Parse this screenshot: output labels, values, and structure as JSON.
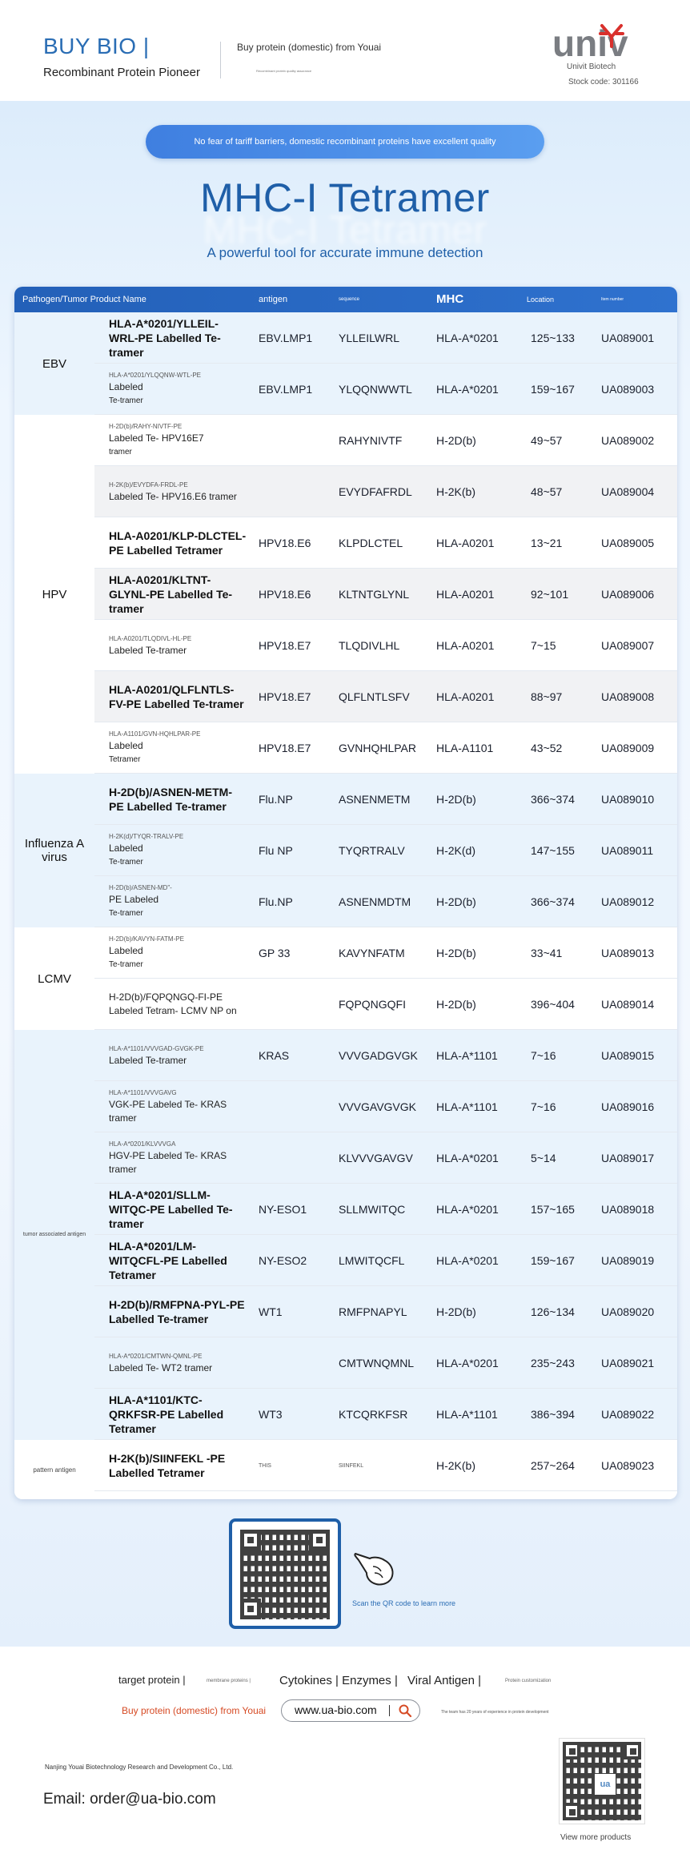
{
  "header": {
    "brand": "BUY BIO |",
    "tagline": "Recombinant Protein Pioneer",
    "buy_domestic": "Buy protein (domestic) from Youai",
    "tiny_note": "Recombinant protein quality assurance",
    "logo_text": "univ",
    "logo_sub": "Univit Biotech",
    "stock": "Stock code: 301166",
    "brand_color": "#2a6db4",
    "logo_red": "#d9302c"
  },
  "hero": {
    "pill": "No fear of tariff barriers, domestic recombinant proteins have excellent quality",
    "title": "MHC-I Tetramer",
    "subtitle": "A powerful tool for accurate immune detection"
  },
  "table": {
    "headers": {
      "category": "Pathogen/Tumor Product Name",
      "antigen": "antigen",
      "sequence": "sequence",
      "mhc": "MHC",
      "location": "Location",
      "item": "Item number"
    },
    "groups": [
      {
        "label": "EBV",
        "rows": [
          {
            "name": "HLA-A*0201/YLLEIL-WRL-PE Labelled Te-tramer",
            "style": "big",
            "antigen": "EBV.LMP1",
            "sequence": "YLLEILWRL",
            "mhc": "HLA-A*0201",
            "location": "125~133",
            "item": "UA089001"
          },
          {
            "name": "Labeled",
            "sub": "HLA-A*0201/YLQQNW-WTL-PE",
            "name2": "Te-tramer",
            "style": "small",
            "antigen": "EBV.LMP1",
            "sequence": "YLQQNWWTL",
            "mhc": "HLA-A*0201",
            "location": "159~167",
            "item": "UA089003"
          }
        ]
      },
      {
        "label": "HPV",
        "rows": [
          {
            "name": "Labeled Te- HPV16E7",
            "sub": "H-2D(b)/RAHY-NIVTF-PE",
            "name2": "tramer",
            "style": "small",
            "antigen": "",
            "sequence": "RAHYNIVTF",
            "mhc": "H-2D(b)",
            "location": "49~57",
            "item": "UA089002"
          },
          {
            "name": "Labeled Te- HPV16.E6 tramer",
            "sub": "H-2K(b)/EVYDFA-FRDL-PE",
            "name2": "",
            "style": "small",
            "antigen": "",
            "sequence": "EVYDFAFRDL",
            "mhc": "H-2K(b)",
            "location": "48~57",
            "item": "UA089004"
          },
          {
            "name": "HLA-A0201/KLP-DLCTEL-PE Labelled Tetramer",
            "style": "big",
            "antigen": "HPV18.E6",
            "sequence": "KLPDLCTEL",
            "mhc": "HLA-A0201",
            "location": "13~21",
            "item": "UA089005"
          },
          {
            "name": "HLA-A0201/KLTNT-GLYNL-PE Labelled Te-tramer",
            "style": "big",
            "antigen": "HPV18.E6",
            "sequence": "KLTNTGLYNL",
            "mhc": "HLA-A0201",
            "location": "92~101",
            "item": "UA089006"
          },
          {
            "name": "Labeled Te-tramer",
            "sub": "HLA-A0201/TLQDIVL-HL-PE",
            "name2": "",
            "style": "small",
            "antigen": "HPV18.E7",
            "sequence": "TLQDIVLHL",
            "mhc": "HLA-A0201",
            "location": "7~15",
            "item": "UA089007"
          },
          {
            "name": "HLA-A0201/QLFLNTLS-FV-PE Labelled Te-tramer",
            "style": "big",
            "antigen": "HPV18.E7",
            "sequence": "QLFLNTLSFV",
            "mhc": "HLA-A0201",
            "location": "88~97",
            "item": "UA089008"
          },
          {
            "name": "Labeled",
            "sub": "HLA-A1101/GVN-HQHLPAR-PE",
            "name2": "Tetramer",
            "style": "small",
            "antigen": "HPV18.E7",
            "sequence": "GVNHQHLPAR",
            "mhc": "HLA-A1101",
            "location": "43~52",
            "item": "UA089009"
          }
        ]
      },
      {
        "label": "Influenza A virus",
        "rows": [
          {
            "name": "H-2D(b)/ASNEN-METM-PE Labelled Te-tramer",
            "style": "big",
            "antigen": "Flu.NP",
            "sequence": "ASNENMETM",
            "mhc": "H-2D(b)",
            "location": "366~374",
            "item": "UA089010"
          },
          {
            "name": "Labeled",
            "sub": "H-2K(d)/TYQR-TRALV-PE",
            "name2": "Te-tramer",
            "style": "small",
            "antigen": "Flu NP",
            "sequence": "TYQRTRALV",
            "mhc": "H-2K(d)",
            "location": "147~155",
            "item": "UA089011"
          },
          {
            "name": "PE Labeled",
            "sub": "H-2D(b)/ASNEN-MD\"-",
            "name2": "Te-tramer",
            "style": "small",
            "antigen": "Flu.NP",
            "sequence": "ASNENMDTM",
            "mhc": "H-2D(b)",
            "location": "366~374",
            "item": "UA089012"
          }
        ]
      },
      {
        "label": "LCMV",
        "rows": [
          {
            "name": "Labeled",
            "sub": "H-2D(b)/KAVYN-FATM-PE",
            "name2": "Te-tramer",
            "style": "small",
            "antigen": "GP 33",
            "sequence": "KAVYNFATM",
            "mhc": "H-2D(b)",
            "location": "33~41",
            "item": "UA089013"
          },
          {
            "name": "H-2D(b)/FQPQNGQ-FI-PE Labeled Tetram- LCMV NP on",
            "style": "plain",
            "antigen": "",
            "sequence": "FQPQNGQFI",
            "mhc": "H-2D(b)",
            "location": "396~404",
            "item": "UA089014"
          }
        ]
      },
      {
        "label": "tumor associated antigen",
        "rows": [
          {
            "name": "Labeled Te-tramer",
            "sub": "HLA-A*1101/VVVGAD-GVGK-PE",
            "name2": "",
            "style": "small",
            "antigen": "KRAS",
            "sequence": "VVVGADGVGK",
            "mhc": "HLA-A*1101",
            "location": "7~16",
            "item": "UA089015"
          },
          {
            "name": "VGK-PE Labeled Te- KRAS tramer",
            "sub": "HLA-A*1101/VVVGAVG",
            "name2": "",
            "style": "small",
            "antigen": "",
            "sequence": "VVVGAVGVGK",
            "mhc": "HLA-A*1101",
            "location": "7~16",
            "item": "UA089016"
          },
          {
            "name": "HGV-PE Labeled Te- KRAS tramer",
            "sub": "HLA-A*0201/KLVVVGA",
            "name2": "",
            "style": "small",
            "antigen": "",
            "sequence": "KLVVVGAVGV",
            "mhc": "HLA-A*0201",
            "location": "5~14",
            "item": "UA089017"
          },
          {
            "name": "HLA-A*0201/SLLM-WITQC-PE Labelled Te-tramer",
            "style": "big",
            "antigen": "NY-ESO1",
            "sequence": "SLLMWITQC",
            "mhc": "HLA-A*0201",
            "location": "157~165",
            "item": "UA089018"
          },
          {
            "name": "HLA-A*0201/LM-WITQCFL-PE Labelled Tetramer",
            "style": "big",
            "antigen": "NY-ESO2",
            "sequence": "LMWITQCFL",
            "mhc": "HLA-A*0201",
            "location": "159~167",
            "item": "UA089019"
          },
          {
            "name": "H-2D(b)/RMFPNA-PYL-PE Labelled Te-tramer",
            "style": "big",
            "antigen": "WT1",
            "sequence": "RMFPNAPYL",
            "mhc": "H-2D(b)",
            "location": "126~134",
            "item": "UA089020"
          },
          {
            "name": "Labeled Te- WT2 tramer",
            "sub": "HLA-A*0201/CMTWN-QMNL-PE",
            "name2": "",
            "style": "small",
            "antigen": "",
            "sequence": "CMTWNQMNL",
            "mhc": "HLA-A*0201",
            "location": "235~243",
            "item": "UA089021"
          },
          {
            "name": "HLA-A*1101/KTC-QRKFSR-PE Labelled Tetramer",
            "style": "big",
            "antigen": "WT3",
            "sequence": "KTCQRKFSR",
            "mhc": "HLA-A*1101",
            "location": "386~394",
            "item": "UA089022"
          }
        ]
      },
      {
        "label": "pattern antigen",
        "rows": [
          {
            "name": "H-2K(b)/SIINFEKL -PE Labelled Tetramer",
            "style": "big",
            "antigen": "THIS",
            "sequence": "SIINFEKL",
            "mhc": "H-2K(b)",
            "location": "257~264",
            "item": "UA089023",
            "small_cells": true
          }
        ]
      }
    ]
  },
  "qr": {
    "scan_text": "Scan the QR code to learn more"
  },
  "footer": {
    "nav": [
      "target protein |",
      "membrane proteins |",
      "Cytokines | Enzymes |",
      "Viral Antigen |",
      "Protein customization"
    ],
    "buy_red": "Buy protein (domestic) from Youai",
    "website": "www.ua-bio.com",
    "team_note": "The team has 20 years of experience in protein development",
    "company": "Nanjing Youai Biotechnology Research and Development Co., Ltd.",
    "email": "Email: order@ua-bio.com",
    "qr_logo": "ua",
    "view_more": "View more products"
  }
}
